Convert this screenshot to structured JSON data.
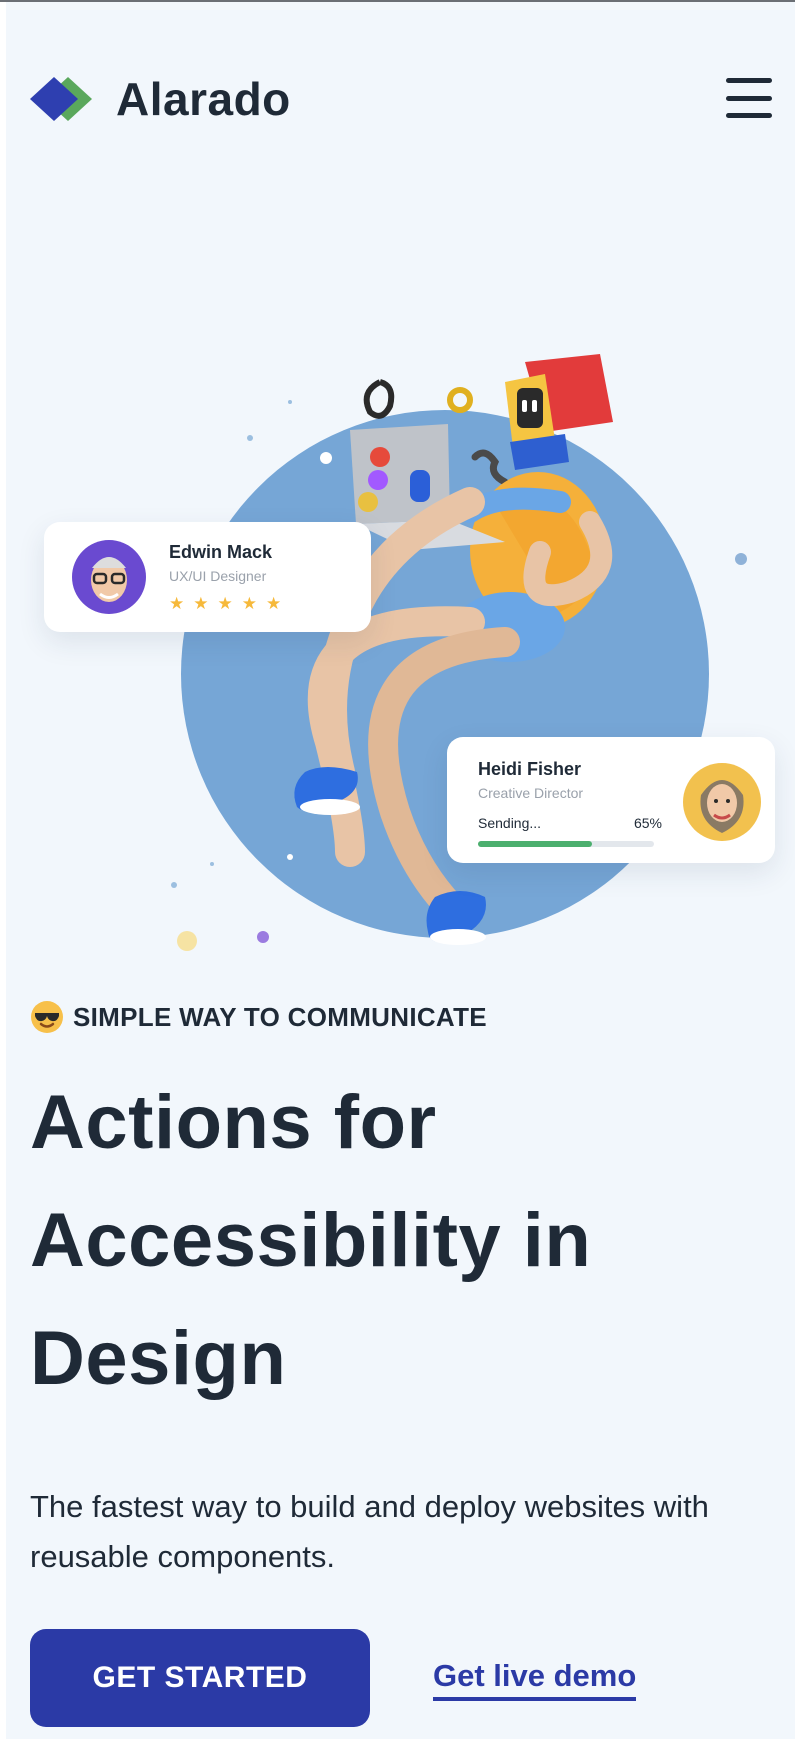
{
  "header": {
    "brand": "Alarado",
    "logo_icon": "diamond-logo-icon",
    "menu_icon": "hamburger-menu-icon"
  },
  "hero": {
    "illustration": "3d-character-with-laptop-illustration",
    "card_left": {
      "name": "Edwin Mack",
      "role": "UX/UI Designer",
      "rating_stars": 5,
      "stars_text": "★★★★★"
    },
    "card_right": {
      "name": "Heidi Fisher",
      "role": "Creative Director",
      "status": "Sending...",
      "progress_label": "65%",
      "progress": 0.65
    }
  },
  "content": {
    "eyebrow_icon": "sunglasses-emoji-icon",
    "eyebrow": "SIMPLE WAY TO COMMUNICATE",
    "headline": "Actions for Accessibility in Design",
    "subtext": "The fastest way to build and deploy websites with reusable components.",
    "cta_primary": "GET STARTED",
    "cta_secondary": "Get live demo"
  },
  "colors": {
    "background": "#f2f7fc",
    "primary": "#2b3aa6",
    "text": "#1f2a37",
    "circle": "#76a6d6",
    "progress": "#4caf6e",
    "star": "#f6b93b",
    "logo_blue": "#2e3fb0",
    "logo_green": "#5aa85c"
  }
}
